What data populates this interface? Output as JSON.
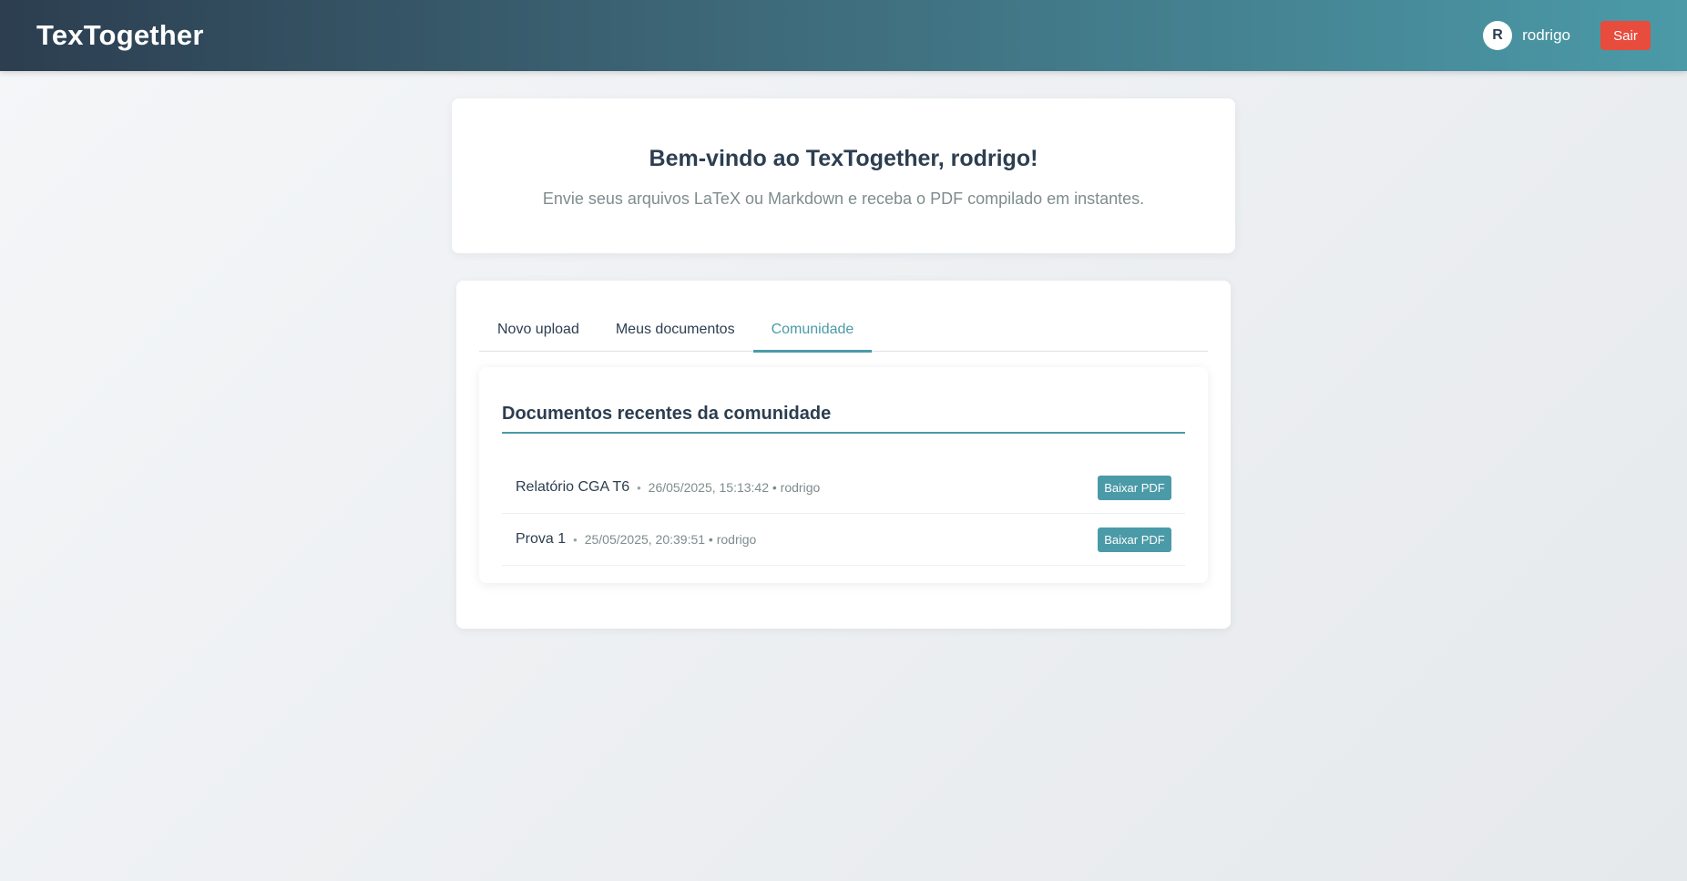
{
  "header": {
    "app_title": "TexTogether",
    "user_initial": "R",
    "username": "rodrigo",
    "logout_label": "Sair"
  },
  "welcome": {
    "title": "Bem-vindo ao TexTogether, rodrigo!",
    "subtitle": "Envie seus arquivos LaTeX ou Markdown e receba o PDF compilado em instantes."
  },
  "tabs": [
    {
      "label": "Novo upload",
      "active": false
    },
    {
      "label": "Meus documentos",
      "active": false
    },
    {
      "label": "Comunidade",
      "active": true
    }
  ],
  "community": {
    "title": "Documentos recentes da comunidade",
    "separator": "•",
    "documents": [
      {
        "title": "Relatório CGA T6",
        "meta": "26/05/2025, 15:13:42 • rodrigo",
        "action_label": "Baixar PDF"
      },
      {
        "title": "Prova 1",
        "meta": "25/05/2025, 20:39:51 • rodrigo",
        "action_label": "Baixar PDF"
      }
    ]
  },
  "colors": {
    "accent": "#4b9aa8",
    "danger": "#e74c3c",
    "header_dark": "#2c3e50"
  }
}
